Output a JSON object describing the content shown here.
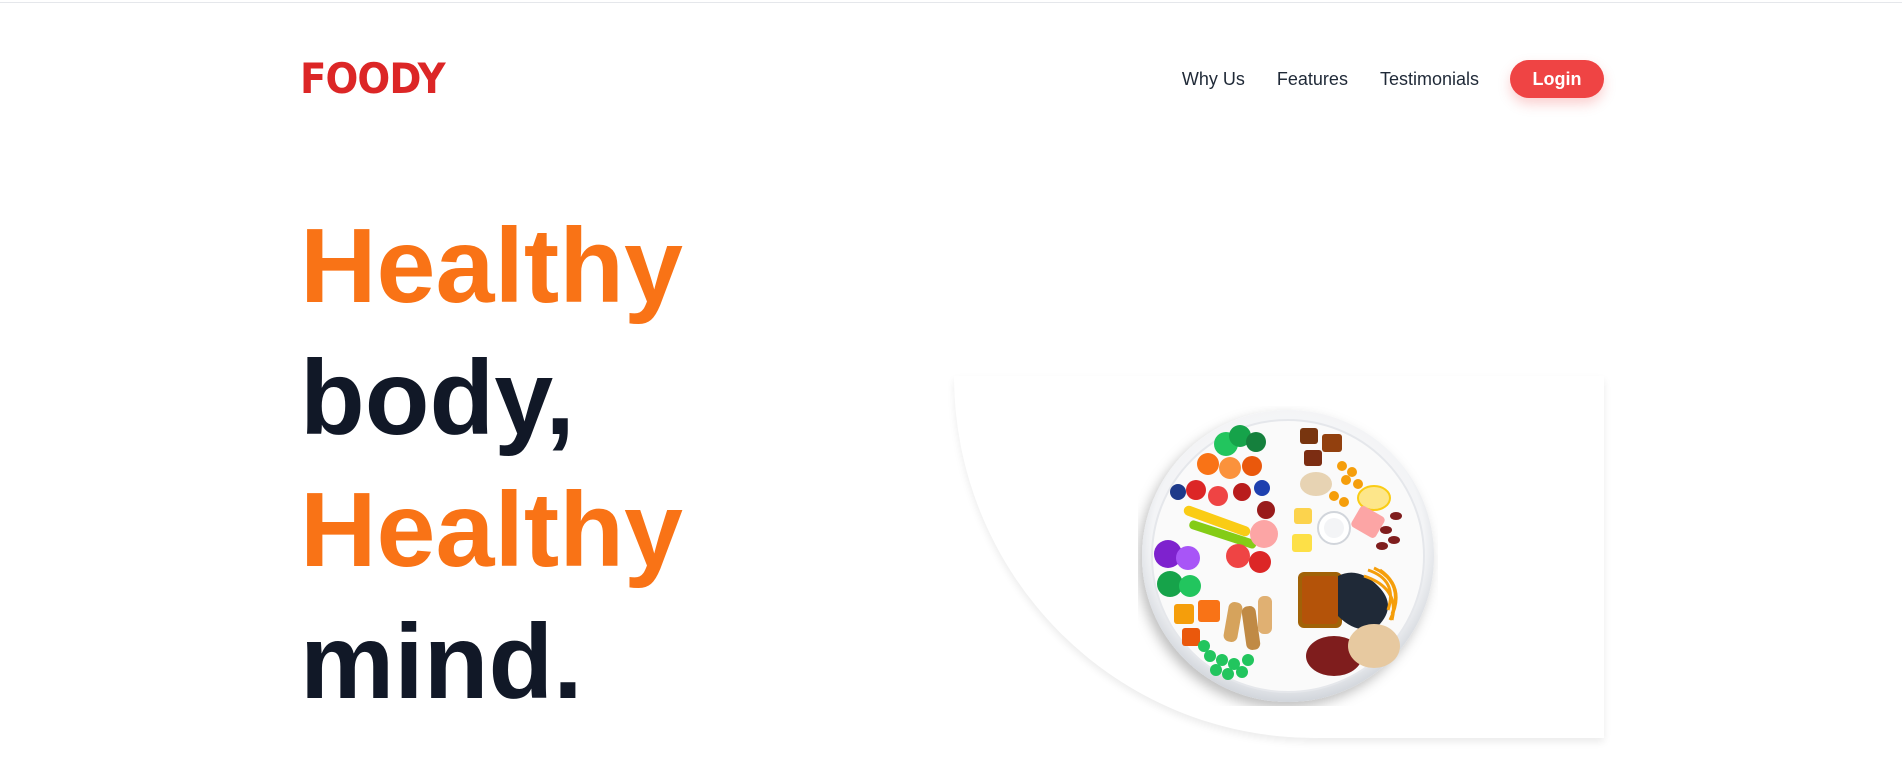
{
  "logo": {
    "text": "FOODY",
    "color": "#dc2626"
  },
  "nav": {
    "links": [
      {
        "label": "Why Us"
      },
      {
        "label": "Features"
      },
      {
        "label": "Testimonials"
      }
    ],
    "login_label": "Login",
    "login_color": "#ef4444"
  },
  "hero": {
    "line1": "Healthy",
    "line2": "body,",
    "line3": "Healthy",
    "line4": "mind.",
    "accent_color": "#f97316",
    "dark_color": "#111827"
  },
  "image": {
    "subject": "healthy-food-plate"
  }
}
